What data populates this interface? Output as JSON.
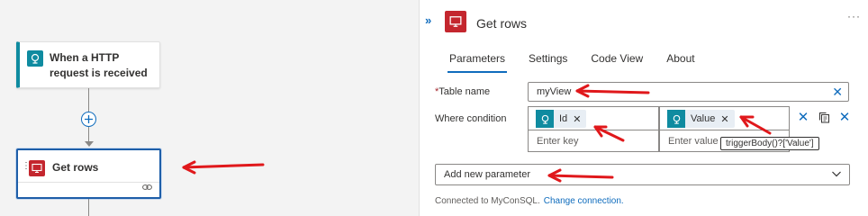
{
  "canvas": {
    "trigger_card": {
      "title": "When a HTTP request is received",
      "icon": "http-request-icon"
    },
    "getrows_card": {
      "title": "Get rows",
      "icon": "sql-icon"
    },
    "add_step_icon": "plus-icon"
  },
  "panel": {
    "collapse_icon": "double-chevron-right-icon",
    "title": "Get rows",
    "more_label": "···",
    "tabs": [
      {
        "label": "Parameters",
        "active": true
      },
      {
        "label": "Settings",
        "active": false
      },
      {
        "label": "Code View",
        "active": false
      },
      {
        "label": "About",
        "active": false
      }
    ],
    "table_name": {
      "required_marker": "*",
      "label": "Table name",
      "value": "myView"
    },
    "where_condition": {
      "label": "Where condition",
      "key_token": "Id",
      "value_token": "Value",
      "key_placeholder": "Enter key",
      "value_placeholder": "Enter value",
      "tooltip": "triggerBody()?['Value']"
    },
    "add_parameter": {
      "label": "Add new parameter"
    },
    "connection": {
      "text": "Connected to MyConSQL.",
      "link": "Change connection."
    }
  },
  "colors": {
    "accent": "#0f6cbd",
    "teal": "#0f8ba0",
    "sql_red": "#c4262e",
    "annotation_arrow": "#e0181b"
  }
}
